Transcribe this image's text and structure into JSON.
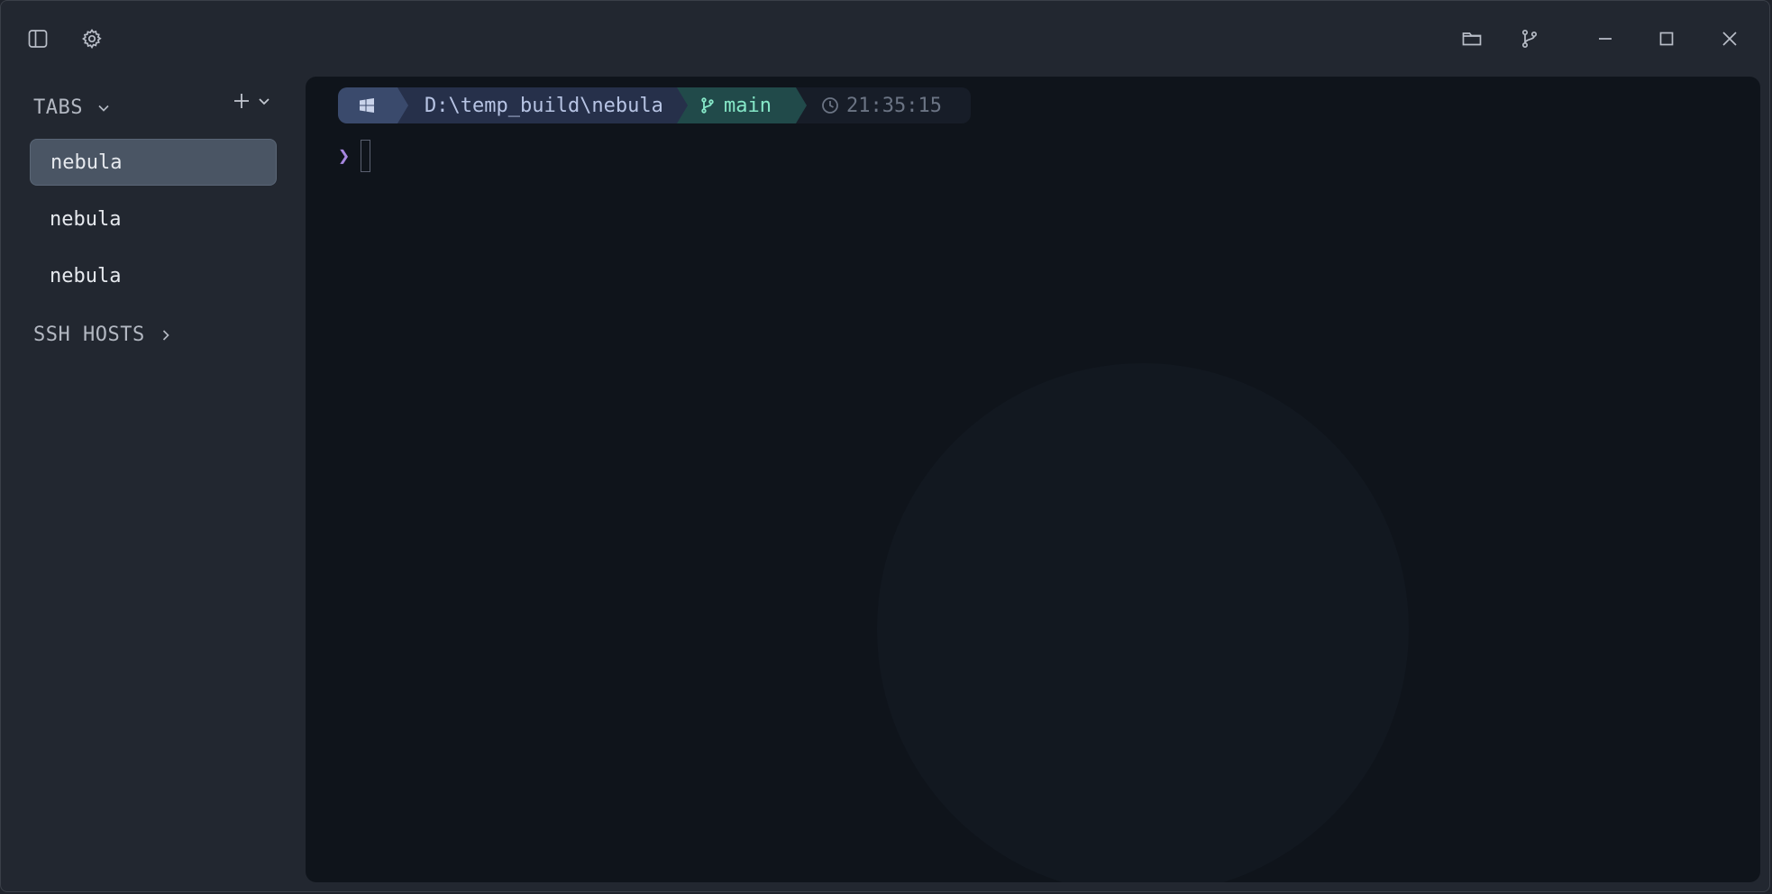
{
  "titlebar": {
    "left_icons": [
      {
        "name": "sidebar-toggle-icon"
      },
      {
        "name": "gear-icon"
      }
    ],
    "right_icons": [
      {
        "name": "folder-icon"
      },
      {
        "name": "git-branch-icon"
      },
      {
        "name": "minimize-icon"
      },
      {
        "name": "maximize-icon"
      },
      {
        "name": "close-icon"
      }
    ]
  },
  "sidebar": {
    "tabs_header": "TABS",
    "tabs": [
      {
        "label": "nebula",
        "active": true
      },
      {
        "label": "nebula",
        "active": false
      },
      {
        "label": "nebula",
        "active": false
      }
    ],
    "ssh_header": "SSH HOSTS"
  },
  "terminal": {
    "prompt": {
      "os_icon": "windows-icon",
      "path": "D:\\temp_build\\nebula",
      "git_branch": "main",
      "time": "21:35:15"
    },
    "prompt_char": "❯"
  },
  "colors": {
    "window_bg": "#222730",
    "terminal_bg": "#0f141b",
    "active_tab": "#4a5564",
    "path_segment": "#26304a",
    "git_segment": "#214a4a",
    "git_text": "#86e8c8",
    "prompt_char": "#a787e0"
  }
}
